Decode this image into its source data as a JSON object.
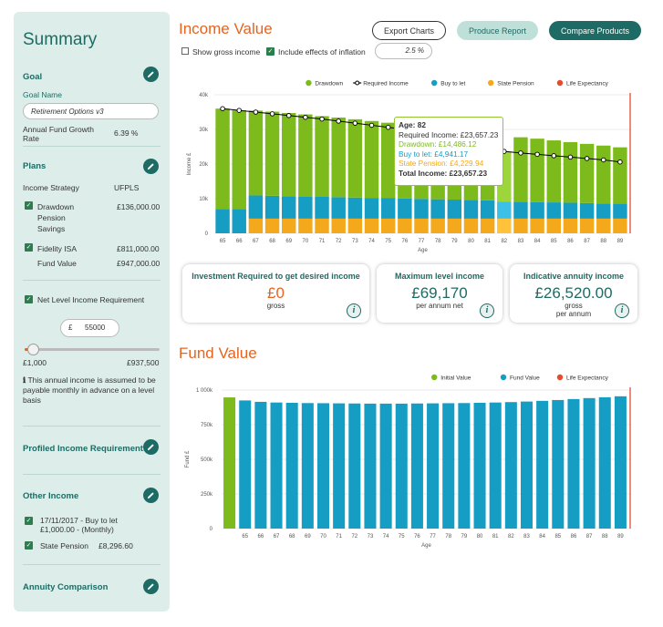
{
  "sidebar": {
    "title": "Summary",
    "goal": {
      "heading": "Goal",
      "name_label": "Goal Name",
      "name_value": "Retirement Options v3",
      "growth_label": "Annual Fund Growth Rate",
      "growth_value": "6.39 %"
    },
    "plans": {
      "heading": "Plans",
      "strategy_label": "Income Strategy",
      "strategy_value": "UFPLS",
      "items": [
        {
          "label": "Drawdown Pension Savings",
          "value": "£136,000.00"
        },
        {
          "label": "Fidelity ISA",
          "value": "£811,000.00"
        }
      ],
      "fund_value_label": "Fund Value",
      "fund_value": "£947,000.00"
    },
    "income_req": {
      "label": "Net Level Income Requirement",
      "currency": "£",
      "amount": "55000",
      "slider_min": "£1,000",
      "slider_max": "£937,500",
      "slider_fraction": 0.06,
      "note": "This annual income is assumed to be payable monthly in advance on a level basis"
    },
    "profiled_heading": "Profiled Income Requirements",
    "other_income": {
      "heading": "Other Income",
      "items": [
        {
          "label": "17/11/2017 - Buy to let £1,000.00 - (Monthly)",
          "value": ""
        },
        {
          "label": "State Pension",
          "value": "£8,296.60"
        }
      ]
    },
    "annuity_heading": "Annuity Comparison"
  },
  "header": {
    "title": "Income Value",
    "export_label": "Export Charts",
    "report_label": "Produce Report",
    "compare_label": "Compare Products"
  },
  "options": {
    "gross_label": "Show gross income",
    "gross_checked": false,
    "inflation_label": "Include effects of inflation",
    "inflation_checked": true,
    "inflation_value": "2.5 %"
  },
  "colors": {
    "drawdown": "#7dbb1d",
    "buy_to_let": "#169dc4",
    "state_pension": "#f4a81b",
    "life_expectancy": "#e94a2c",
    "teal": "#1d6b64",
    "orange": "#e8631f"
  },
  "chart_data": [
    {
      "type": "bar",
      "xlabel": "Age",
      "ylabel": "Income £",
      "ylim": [
        0,
        40000
      ],
      "yticks": [
        "0",
        "10k",
        "20k",
        "30k",
        "40k"
      ],
      "legend": [
        "Drawdown",
        "Required Income",
        "Buy to let",
        "State Pension",
        "Life Expectancy"
      ],
      "legend_position": "top-right",
      "categories": [
        "65",
        "66",
        "67",
        "68",
        "69",
        "70",
        "71",
        "72",
        "73",
        "74",
        "75",
        "76",
        "77",
        "78",
        "79",
        "80",
        "81",
        "82",
        "83",
        "84",
        "85",
        "86",
        "87",
        "88",
        "89"
      ],
      "series": [
        {
          "name": "State Pension",
          "values": [
            0,
            0,
            4229,
            4229,
            4229,
            4229,
            4229,
            4229,
            4229,
            4229,
            4229,
            4229,
            4229,
            4229,
            4229,
            4229,
            4229,
            4229,
            4229,
            4229,
            4229,
            4229,
            4229,
            4229,
            4229
          ]
        },
        {
          "name": "Buy to let",
          "values": [
            7000,
            7000,
            6700,
            6600,
            6500,
            6400,
            6300,
            6200,
            6100,
            6000,
            5900,
            5800,
            5700,
            5600,
            5500,
            5400,
            5300,
            4941,
            4900,
            4800,
            4700,
            4600,
            4500,
            4400,
            4300
          ]
        },
        {
          "name": "Drawdown",
          "values": [
            29000,
            28500,
            24500,
            24300,
            24000,
            23700,
            23300,
            23000,
            22600,
            22200,
            21800,
            21500,
            21100,
            20800,
            20400,
            20000,
            19600,
            14486,
            18600,
            18300,
            17900,
            17500,
            17100,
            16700,
            16300
          ]
        }
      ],
      "required_income": [
        36000,
        35500,
        35000,
        34500,
        34000,
        33500,
        33000,
        32400,
        31800,
        31200,
        30600,
        30000,
        29400,
        28800,
        28200,
        27600,
        26500,
        23657,
        23200,
        22800,
        22400,
        22000,
        21600,
        21200,
        20600
      ],
      "life_expectancy_age": "89",
      "tooltip": {
        "age_label": "Age: 82",
        "required": "Required Income: £23,657.23",
        "drawdown": "Drawdown: £14,486.12",
        "buy_to_let": "Buy to let: £4,941.17",
        "state_pension": "State Pension: £4,229.94",
        "total": "Total Income: £23,657.23"
      }
    },
    {
      "type": "bar",
      "xlabel": "Age",
      "ylabel": "Fund £",
      "ylim": [
        0,
        1000000
      ],
      "yticks": [
        "0",
        "250k",
        "500k",
        "750k",
        "1 000k"
      ],
      "legend": [
        "Initial Value",
        "Fund Value",
        "Life Expectancy"
      ],
      "legend_position": "top-right",
      "categories": [
        "",
        "65",
        "66",
        "67",
        "68",
        "69",
        "70",
        "71",
        "72",
        "73",
        "74",
        "75",
        "76",
        "77",
        "78",
        "79",
        "80",
        "81",
        "82",
        "83",
        "84",
        "85",
        "86",
        "87",
        "88",
        "89"
      ],
      "series": [
        {
          "name": "Initial Value",
          "values": [
            947000,
            0,
            0,
            0,
            0,
            0,
            0,
            0,
            0,
            0,
            0,
            0,
            0,
            0,
            0,
            0,
            0,
            0,
            0,
            0,
            0,
            0,
            0,
            0,
            0,
            0
          ]
        },
        {
          "name": "Fund Value",
          "values": [
            0,
            925000,
            915000,
            910000,
            908000,
            906000,
            905000,
            904000,
            903000,
            902000,
            902000,
            902000,
            903000,
            904000,
            905000,
            906000,
            908000,
            910000,
            913000,
            917000,
            922000,
            928000,
            935000,
            942000,
            948000,
            955000
          ]
        }
      ],
      "life_expectancy_age": "89"
    }
  ],
  "cards": [
    {
      "title": "Investment Required to get desired income",
      "value": "£0",
      "sub1": "gross",
      "sub2": ""
    },
    {
      "title": "Maximum level income",
      "value": "£69,170",
      "sub1": "per annum net",
      "sub2": ""
    },
    {
      "title": "Indicative annuity income",
      "value": "£26,520.00",
      "sub1": "gross",
      "sub2": "per annum"
    }
  ],
  "fund": {
    "title": "Fund Value"
  }
}
